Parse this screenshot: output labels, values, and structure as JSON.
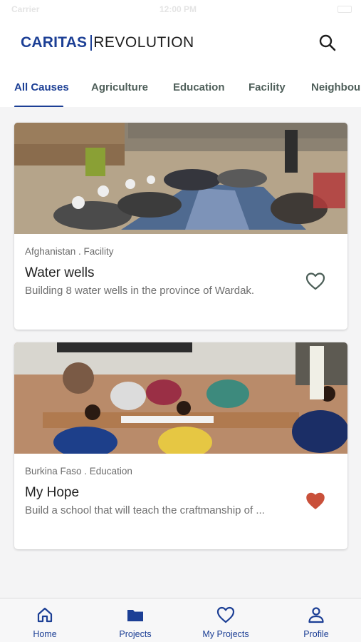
{
  "status_bar": {
    "carrier": "Carrier",
    "time": "12:00 PM",
    "battery": ""
  },
  "header": {
    "logo_primary": "CARITAS",
    "logo_secondary": "REVOLUTION",
    "search_icon": "search-icon"
  },
  "tabs": [
    {
      "label": "All Causes",
      "active": true
    },
    {
      "label": "Agriculture",
      "active": false
    },
    {
      "label": "Education",
      "active": false
    },
    {
      "label": "Facility",
      "active": false
    },
    {
      "label": "Neighbourhood",
      "active": false
    }
  ],
  "cards": [
    {
      "location_category": "Afghanistan . Facility",
      "title": "Water wells",
      "description": "Building 8 water wells in the province of Wardak.",
      "favorited": false,
      "photo": "photo of men seated on a carpet outdoors"
    },
    {
      "location_category": "Burkina Faso . Education",
      "title": "My Hope",
      "description": "Build a school that will teach the craftmanship of ...",
      "favorited": true,
      "photo": "photo of children studying at outdoor desks"
    }
  ],
  "tab_bar": [
    {
      "label": "Home",
      "icon": "home-icon"
    },
    {
      "label": "Projects",
      "icon": "folder-icon"
    },
    {
      "label": "My Projects",
      "icon": "heart-icon"
    },
    {
      "label": "Profile",
      "icon": "person-icon"
    }
  ],
  "colors": {
    "brand_blue": "#1c3f95",
    "heart_fill": "#c9503a",
    "heart_outline": "#4b5e57",
    "tab_inactive": "#4f5f5a"
  }
}
